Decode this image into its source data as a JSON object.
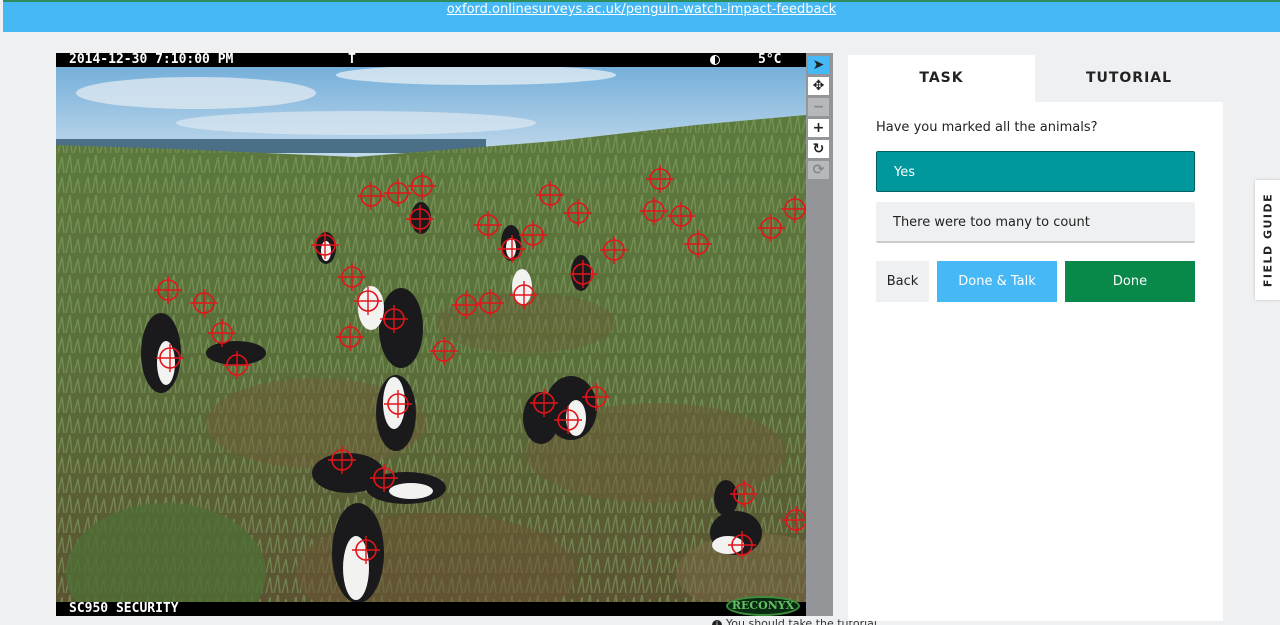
{
  "banner": {
    "url_text": "oxford.onlinesurveys.ac.uk/penguin-watch-impact-feedback"
  },
  "camera": {
    "timestamp": "2014-12-30 7:10:00 PM",
    "marker": "T",
    "temperature": "5°C",
    "model": "SC950 SECURITY",
    "brand": "RECONYX"
  },
  "toolbar": {
    "tools": [
      {
        "name": "pointer-icon",
        "glyph": "➤",
        "state": "active"
      },
      {
        "name": "move-icon",
        "glyph": "✥",
        "state": "normal"
      },
      {
        "name": "zoom-out-icon",
        "glyph": "−",
        "state": "disabled"
      },
      {
        "name": "zoom-in-icon",
        "glyph": "+",
        "state": "normal"
      },
      {
        "name": "rotate-icon",
        "glyph": "↻",
        "state": "normal"
      },
      {
        "name": "reset-icon",
        "glyph": "⟳",
        "state": "disabled"
      }
    ]
  },
  "tutorial_link": {
    "text": "You should take the tutorial"
  },
  "tabs": {
    "task": "TASK",
    "tutorial": "TUTORIAL"
  },
  "task": {
    "question": "Have you marked all the animals?",
    "answers": [
      "Yes",
      "There were too many to count"
    ],
    "selected": 0
  },
  "buttons": {
    "back": "Back",
    "done_talk": "Done & Talk",
    "done": "Done"
  },
  "field_guide": "FIELD GUIDE",
  "colors": {
    "banner": "#45b8f5",
    "selected_answer": "#00979d",
    "done_talk": "#45b8f5",
    "done": "#08894a",
    "marker": "#e3141a"
  }
}
